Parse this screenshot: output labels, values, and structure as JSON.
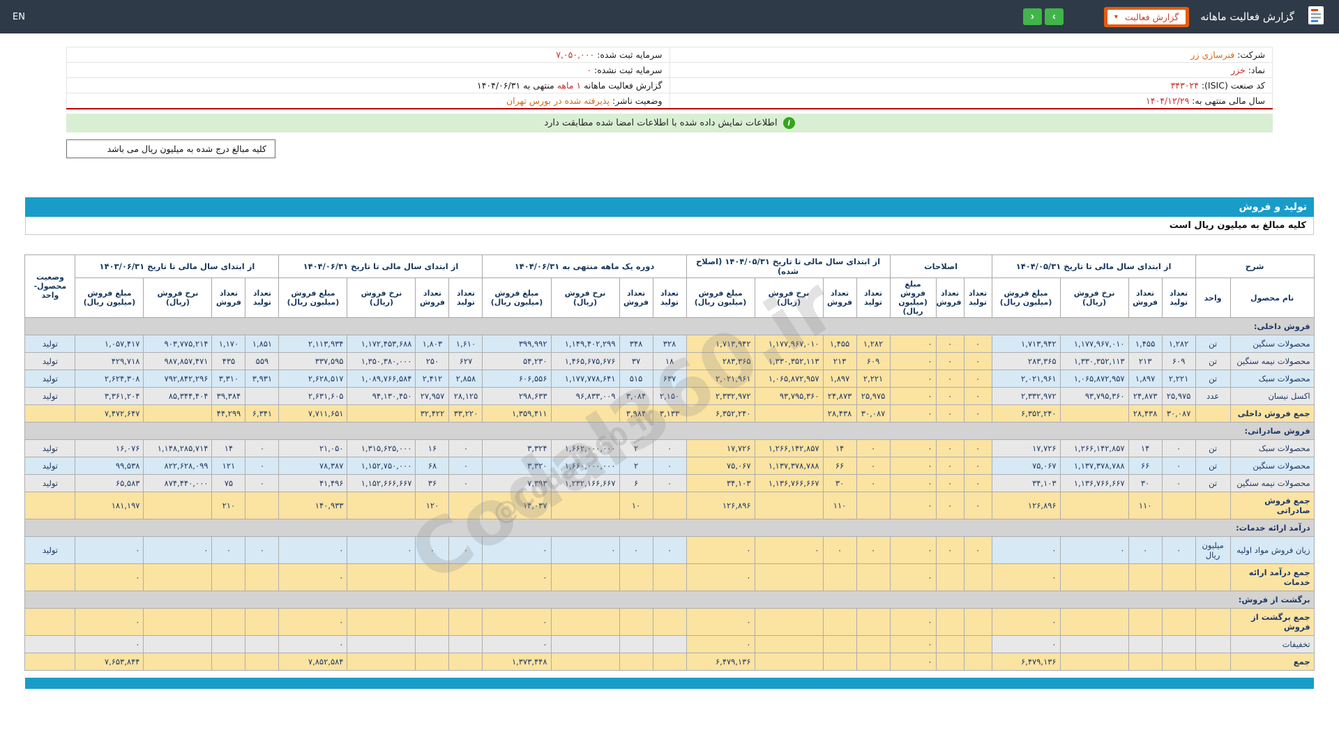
{
  "colors": {
    "navbar_bg": "#2E3A47",
    "accent_cyan": "#1A9CC9",
    "button_orange": "#E85B0C",
    "button_green": "#41B549",
    "highlight_yellow": "#FBE3A2",
    "stripe_blue": "#D6E9F5",
    "stripe_gray": "#E8E8E8",
    "section_gray": "#D3D3D3",
    "banner_green": "#D8EFD3",
    "red_line": "#C00000"
  },
  "navbar": {
    "en": "EN",
    "title": "گزارش فعالیت ماهانه",
    "select_label": "گزارش فعالیت",
    "caret": "▾",
    "next": "›",
    "prev": "‹"
  },
  "info": {
    "rows": [
      {
        "right": [
          {
            "t": "شرکت:  ",
            "c": "label"
          },
          {
            "t": "فنرسازي زر",
            "c": "orange"
          }
        ],
        "left": [
          {
            "t": "سرمایه ثبت شده:  ",
            "c": "label"
          },
          {
            "t": "۷,۰۵۰,۰۰۰",
            "c": "red"
          }
        ]
      },
      {
        "right": [
          {
            "t": "نماد:  ",
            "c": "label"
          },
          {
            "t": "خزر",
            "c": "red"
          }
        ],
        "left": [
          {
            "t": "سرمایه ثبت نشده:  ",
            "c": "label"
          },
          {
            "t": "۰",
            "c": "red"
          }
        ]
      },
      {
        "right": [
          {
            "t": "کد صنعت (ISIC):  ",
            "c": "label"
          },
          {
            "t": "۳۴۳۰۲۴",
            "c": "red"
          }
        ],
        "left": [
          {
            "t": "گزارش فعالیت ماهانه ",
            "c": "label"
          },
          {
            "t": "۱ ماهه",
            "c": "red"
          },
          {
            "t": " منتهی به ۱۴۰۴/۰۶/۳۱",
            "c": "label"
          }
        ]
      },
      {
        "right": [
          {
            "t": "سال مالی منتهی به:  ",
            "c": "label"
          },
          {
            "t": "۱۴۰۴/۱۲/۲۹",
            "c": "red"
          }
        ],
        "left": [
          {
            "t": "وضعیت ناشر:  ",
            "c": "label"
          },
          {
            "t": "پذیرفته شده در بورس تهران",
            "c": "orange"
          }
        ]
      }
    ]
  },
  "banner": {
    "icon": "i",
    "text": "اطلاعات نمایش داده شده با اطلاعات امضا شده مطابقت دارد"
  },
  "notes": {
    "amounts_note": "کلیه مبالغ درج شده به میلیون ریال می باشد"
  },
  "section": {
    "title": "تولید و فروش",
    "subtitle": "کلیه مبالغ به میلیون ریال است"
  },
  "watermark": {
    "main": "Codal360.ir",
    "handle": "@Codal360_ir"
  },
  "table": {
    "header": {
      "sharh": "شرح",
      "product": "نام محصول",
      "unit": "واحد",
      "status": "وضعیت محصول-واحد",
      "groups": [
        {
          "title": "از ابتدای سال مالی تا تاریخ ۱۴۰۴/۰۵/۳۱",
          "cols": [
            "تعداد تولید",
            "تعداد فروش",
            "نرخ فروش (ریال)",
            "مبلغ فروش (میلیون ریال)"
          ]
        },
        {
          "title": "اصلاحات",
          "cols": [
            "تعداد تولید",
            "تعداد فروش",
            "مبلغ فروش (میلیون ریال)"
          ]
        },
        {
          "title": "از ابتدای سال مالی تا تاریخ ۱۴۰۴/۰۵/۳۱ (اصلاح شده)",
          "cols": [
            "تعداد تولید",
            "تعداد فروش",
            "نرخ فروش (ریال)",
            "مبلغ فروش (میلیون ریال)"
          ]
        },
        {
          "title": "دوره یک ماهه منتهی به ۱۴۰۴/۰۶/۳۱",
          "cols": [
            "تعداد تولید",
            "تعداد فروش",
            "نرخ فروش (ریال)",
            "مبلغ فروش (میلیون ریال)"
          ]
        },
        {
          "title": "از ابتدای سال مالی تا تاریخ ۱۴۰۴/۰۶/۳۱",
          "cols": [
            "تعداد تولید",
            "تعداد فروش",
            "نرخ فروش (ریال)",
            "مبلغ فروش (میلیون ریال)"
          ]
        },
        {
          "title": "از ابتدای سال مالی تا تاریخ ۱۴۰۳/۰۶/۳۱",
          "cols": [
            "تعداد تولید",
            "تعداد فروش",
            "نرخ فروش (ریال)",
            "مبلغ فروش (میلیون ریال)"
          ]
        }
      ]
    },
    "rows": [
      {
        "type": "section",
        "name": "فروش داخلی:"
      },
      {
        "type": "data",
        "tone": "blue",
        "name": "محصولات سنگین",
        "unit": "تن",
        "status": "تولید",
        "cells": [
          "۱,۲۸۲",
          "۱,۴۵۵",
          "۱,۱۷۷,۹۶۷,۰۱۰",
          "۱,۷۱۳,۹۴۲",
          "۰",
          "۰",
          "۰",
          "۱,۲۸۲",
          "۱,۴۵۵",
          "۱,۱۷۷,۹۶۷,۰۱۰",
          "۱,۷۱۳,۹۴۲",
          "۳۲۸",
          "۳۴۸",
          "۱,۱۴۹,۴۰۲,۲۹۹",
          "۳۹۹,۹۹۲",
          "۱,۶۱۰",
          "۱,۸۰۳",
          "۱,۱۷۲,۴۵۳,۶۸۸",
          "۲,۱۱۳,۹۳۴",
          "۱,۸۵۱",
          "۱,۱۷۰",
          "۹۰۳,۷۷۵,۲۱۴",
          "۱,۰۵۷,۴۱۷"
        ]
      },
      {
        "type": "data",
        "tone": "gray",
        "name": "محصولات نیمه سنگین",
        "unit": "تن",
        "status": "تولید",
        "cells": [
          "۶۰۹",
          "۲۱۳",
          "۱,۳۳۰,۳۵۲,۱۱۳",
          "۲۸۳,۳۶۵",
          "۰",
          "۰",
          "۰",
          "۶۰۹",
          "۲۱۳",
          "۱,۳۳۰,۳۵۲,۱۱۳",
          "۲۸۳,۳۶۵",
          "۱۸",
          "۳۷",
          "۱,۴۶۵,۶۷۵,۶۷۶",
          "۵۴,۲۳۰",
          "۶۲۷",
          "۲۵۰",
          "۱,۳۵۰,۳۸۰,۰۰۰",
          "۳۳۷,۵۹۵",
          "۵۵۹",
          "۴۳۵",
          "۹۸۷,۸۵۷,۴۷۱",
          "۴۲۹,۷۱۸"
        ]
      },
      {
        "type": "data",
        "tone": "blue",
        "name": "محصولات سبک",
        "unit": "تن",
        "status": "تولید",
        "cells": [
          "۲,۲۲۱",
          "۱,۸۹۷",
          "۱,۰۶۵,۸۷۲,۹۵۷",
          "۲,۰۲۱,۹۶۱",
          "۰",
          "۰",
          "۰",
          "۲,۲۲۱",
          "۱,۸۹۷",
          "۱,۰۶۵,۸۷۲,۹۵۷",
          "۲,۰۲۱,۹۶۱",
          "۶۳۷",
          "۵۱۵",
          "۱,۱۷۷,۷۷۸,۶۴۱",
          "۶۰۶,۵۵۶",
          "۲,۸۵۸",
          "۲,۴۱۲",
          "۱,۰۸۹,۷۶۶,۵۸۴",
          "۲,۶۲۸,۵۱۷",
          "۳,۹۳۱",
          "۳,۳۱۰",
          "۷۹۲,۸۴۲,۲۹۶",
          "۲,۶۲۴,۳۰۸"
        ]
      },
      {
        "type": "data",
        "tone": "gray",
        "name": "اکسل نیسان",
        "unit": "عدد",
        "status": "تولید",
        "cells": [
          "۲۵,۹۷۵",
          "۲۴,۸۷۳",
          "۹۳,۷۹۵,۳۶۰",
          "۲,۳۳۲,۹۷۲",
          "۰",
          "۰",
          "۰",
          "۲۵,۹۷۵",
          "۲۴,۸۷۳",
          "۹۳,۷۹۵,۳۶۰",
          "۲,۳۳۲,۹۷۲",
          "۲,۱۵۰",
          "۳,۰۸۴",
          "۹۶,۸۳۳,۰۰۹",
          "۲۹۸,۶۳۳",
          "۲۸,۱۲۵",
          "۲۷,۹۵۷",
          "۹۴,۱۳۰,۴۵۰",
          "۲,۶۳۱,۶۰۵",
          "",
          "۳۹,۳۸۴",
          "۸۵,۳۴۴,۴۰۴",
          "۳,۳۶۱,۲۰۴"
        ]
      },
      {
        "type": "total",
        "tone": "yellow",
        "name": "جمع فروش داخلی",
        "unit": "",
        "status": "",
        "cells": [
          "۳۰,۰۸۷",
          "۲۸,۴۳۸",
          "",
          "۶,۳۵۲,۲۴۰",
          "۰",
          "۰",
          "۰",
          "۳۰,۰۸۷",
          "۲۸,۴۳۸",
          "",
          "۶,۳۵۲,۲۴۰",
          "۳,۱۳۳",
          "۳,۹۸۴",
          "",
          "۱,۳۵۹,۴۱۱",
          "۳۳,۲۲۰",
          "۳۲,۴۲۲",
          "",
          "۷,۷۱۱,۶۵۱",
          "۶,۳۴۱",
          "۴۴,۲۹۹",
          "",
          "۷,۴۷۲,۶۴۷"
        ]
      },
      {
        "type": "section",
        "name": "فروش صادراتی:"
      },
      {
        "type": "data",
        "tone": "gray",
        "name": "محصولات سبک",
        "unit": "تن",
        "status": "تولید",
        "cells": [
          "۰",
          "۱۴",
          "۱,۲۶۶,۱۴۲,۸۵۷",
          "۱۷,۷۲۶",
          "۰",
          "۰",
          "۰",
          "۰",
          "۱۴",
          "۱,۲۶۶,۱۴۲,۸۵۷",
          "۱۷,۷۲۶",
          "۰",
          "۲",
          "۱,۶۶۲,۰۰۰,۰۰۰",
          "۳,۳۲۴",
          "۰",
          "۱۶",
          "۱,۳۱۵,۶۲۵,۰۰۰",
          "۲۱,۰۵۰",
          "۰",
          "۱۴",
          "۱,۱۴۸,۲۸۵,۷۱۴",
          "۱۶,۰۷۶"
        ]
      },
      {
        "type": "data",
        "tone": "blue",
        "name": "محصولات سنگین",
        "unit": "تن",
        "status": "تولید",
        "cells": [
          "۰",
          "۶۶",
          "۱,۱۳۷,۳۷۸,۷۸۸",
          "۷۵,۰۶۷",
          "۰",
          "۰",
          "۰",
          "۰",
          "۶۶",
          "۱,۱۳۷,۳۷۸,۷۸۸",
          "۷۵,۰۶۷",
          "۰",
          "۲",
          "۱,۶۶۰,۰۰۰,۰۰۰",
          "۳,۳۲۰",
          "۰",
          "۶۸",
          "۱,۱۵۲,۷۵۰,۰۰۰",
          "۷۸,۳۸۷",
          "۰",
          "۱۲۱",
          "۸۲۲,۶۲۸,۰۹۹",
          "۹۹,۵۳۸"
        ]
      },
      {
        "type": "data",
        "tone": "gray",
        "name": "محصولات نیمه سنگین",
        "unit": "تن",
        "status": "تولید",
        "cells": [
          "۰",
          "۳۰",
          "۱,۱۳۶,۷۶۶,۶۶۷",
          "۳۴,۱۰۳",
          "۰",
          "۰",
          "۰",
          "۰",
          "۳۰",
          "۱,۱۳۶,۷۶۶,۶۶۷",
          "۳۴,۱۰۳",
          "۰",
          "۶",
          "۱,۲۳۲,۱۶۶,۶۶۷",
          "۷,۳۹۳",
          "۰",
          "۳۶",
          "۱,۱۵۲,۶۶۶,۶۶۷",
          "۴۱,۴۹۶",
          "۰",
          "۷۵",
          "۸۷۴,۴۴۰,۰۰۰",
          "۶۵,۵۸۳"
        ]
      },
      {
        "type": "total",
        "tone": "yellow",
        "name": "جمع فروش صادراتی",
        "unit": "",
        "status": "",
        "cells": [
          "",
          "۱۱۰",
          "",
          "۱۲۶,۸۹۶",
          "۰",
          "۰",
          "۰",
          "",
          "۱۱۰",
          "",
          "۱۲۶,۸۹۶",
          "",
          "۱۰",
          "",
          "۱۴,۰۳۷",
          "",
          "۱۲۰",
          "",
          "۱۴۰,۹۳۳",
          "",
          "۲۱۰",
          "",
          "۱۸۱,۱۹۷"
        ]
      },
      {
        "type": "section",
        "name": "درآمد ارائه خدمات:"
      },
      {
        "type": "data",
        "tone": "blue",
        "name": "زیان فروش مواد اولیه",
        "unit": "میلیون ریال",
        "status": "تولید",
        "cells": [
          "۰",
          "۰",
          "۰",
          "۰",
          "۰",
          "۰",
          "۰",
          "۰",
          "۰",
          "۰",
          "۰",
          "۰",
          "۰",
          "۰",
          "۰",
          "۰",
          "۰",
          "۰",
          "۰",
          "۰",
          "۰",
          "۰",
          "۰"
        ]
      },
      {
        "type": "total",
        "tone": "yellow",
        "name": "جمع درآمد ارائه خدمات",
        "unit": "",
        "status": "",
        "cells": [
          "",
          "",
          "",
          "۰",
          "",
          "",
          "۰",
          "",
          "",
          "",
          "۰",
          "",
          "",
          "",
          "۰",
          "",
          "",
          "",
          "۰",
          "",
          "",
          "",
          "۰"
        ]
      },
      {
        "type": "section",
        "name": "برگشت از فروش:"
      },
      {
        "type": "total",
        "tone": "yellow",
        "name": "جمع برگشت از فروش",
        "unit": "",
        "status": "",
        "cells": [
          "",
          "",
          "",
          "۰",
          "",
          "",
          "۰",
          "",
          "",
          "",
          "۰",
          "",
          "",
          "",
          "۰",
          "",
          "",
          "",
          "۰",
          "",
          "",
          "",
          "۰"
        ]
      },
      {
        "type": "data",
        "tone": "gray",
        "name": "تخفیفات",
        "unit": "",
        "status": "",
        "cells": [
          "",
          "",
          "",
          "۰",
          "",
          "",
          "۰",
          "",
          "",
          "",
          "۰",
          "",
          "",
          "",
          "۰",
          "",
          "",
          "",
          "۰",
          "",
          "",
          "",
          "۰"
        ]
      },
      {
        "type": "total",
        "tone": "yellow",
        "name": "جمع",
        "unit": "",
        "status": "",
        "cells": [
          "",
          "",
          "",
          "۶,۴۷۹,۱۳۶",
          "",
          "",
          "۰",
          "",
          "",
          "",
          "۶,۴۷۹,۱۳۶",
          "",
          "",
          "",
          "۱,۳۷۳,۴۴۸",
          "",
          "",
          "",
          "۷,۸۵۲,۵۸۴",
          "",
          "",
          "",
          "۷,۶۵۳,۸۴۴"
        ]
      }
    ]
  }
}
